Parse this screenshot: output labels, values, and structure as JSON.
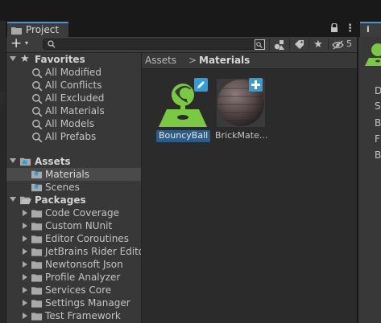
{
  "window": {
    "tab_title": "Project",
    "hidden_count": "5"
  },
  "toolbar": {
    "create_plus": "+",
    "create_caret": "▾",
    "search_placeholder": ""
  },
  "sidebar": {
    "favorites": {
      "label": "Favorites",
      "items": [
        "All Modified",
        "All Conflicts",
        "All Excluded",
        "All Materials",
        "All Models",
        "All Prefabs"
      ]
    },
    "assets": {
      "label": "Assets",
      "items": [
        "Materials",
        "Scenes"
      ],
      "selected": "Materials"
    },
    "packages": {
      "label": "Packages",
      "items": [
        "Code Coverage",
        "Custom NUnit",
        "Editor Coroutines",
        "JetBrains Rider Editor",
        "Newtonsoft Json",
        "Profile Analyzer",
        "Services Core",
        "Settings Manager",
        "Test Framework"
      ]
    }
  },
  "breadcrumb": {
    "root": "Assets",
    "separator": ">",
    "current": "Materials"
  },
  "assets_grid": [
    {
      "name": "BouncyBall",
      "selected": true,
      "icon": "physics-material-icon"
    },
    {
      "name": "BrickMate...",
      "selected": false,
      "icon": "material-sphere-icon"
    }
  ],
  "inspector_stub": {
    "letters": [
      "D",
      "S",
      "B",
      "F",
      "B"
    ]
  },
  "colors": {
    "selection": "#2c5d87",
    "accent_tab": "#4d8fd8",
    "physics_green": "#7ac943",
    "badge_blue": "#2e9fd9"
  }
}
